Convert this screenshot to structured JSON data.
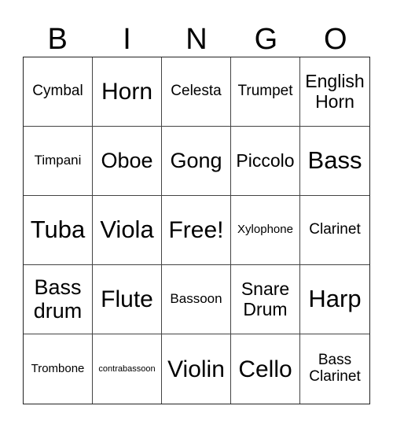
{
  "header": {
    "letters": [
      "B",
      "I",
      "N",
      "G",
      "O"
    ]
  },
  "board": {
    "cells": [
      {
        "text": "Cymbal",
        "size": "fs-m"
      },
      {
        "text": "Horn",
        "size": "fs-xl"
      },
      {
        "text": "Celesta",
        "size": "fs-m"
      },
      {
        "text": "Trumpet",
        "size": "fs-m"
      },
      {
        "text": "English Horn",
        "size": "fs-ml"
      },
      {
        "text": "Timpani",
        "size": "fs-sm"
      },
      {
        "text": "Oboe",
        "size": "fs-l"
      },
      {
        "text": "Gong",
        "size": "fs-l"
      },
      {
        "text": "Piccolo",
        "size": "fs-ml"
      },
      {
        "text": "Bass",
        "size": "fs-xxl"
      },
      {
        "text": "Tuba",
        "size": "fs-xxl"
      },
      {
        "text": "Viola",
        "size": "fs-xxl"
      },
      {
        "text": "Free!",
        "size": "fs-xl"
      },
      {
        "text": "Xylophone",
        "size": "fs-s"
      },
      {
        "text": "Clarinet",
        "size": "fs-m"
      },
      {
        "text": "Bass drum",
        "size": "fs-l"
      },
      {
        "text": "Flute",
        "size": "fs-xl"
      },
      {
        "text": "Bassoon",
        "size": "fs-sm"
      },
      {
        "text": "Snare Drum",
        "size": "fs-ml"
      },
      {
        "text": "Harp",
        "size": "fs-xxl"
      },
      {
        "text": "Trombone",
        "size": "fs-s"
      },
      {
        "text": "contrabassoon",
        "size": "fs-xs"
      },
      {
        "text": "Violin",
        "size": "fs-xl"
      },
      {
        "text": "Cello",
        "size": "fs-xl"
      },
      {
        "text": "Bass Clarinet",
        "size": "fs-m"
      }
    ]
  }
}
